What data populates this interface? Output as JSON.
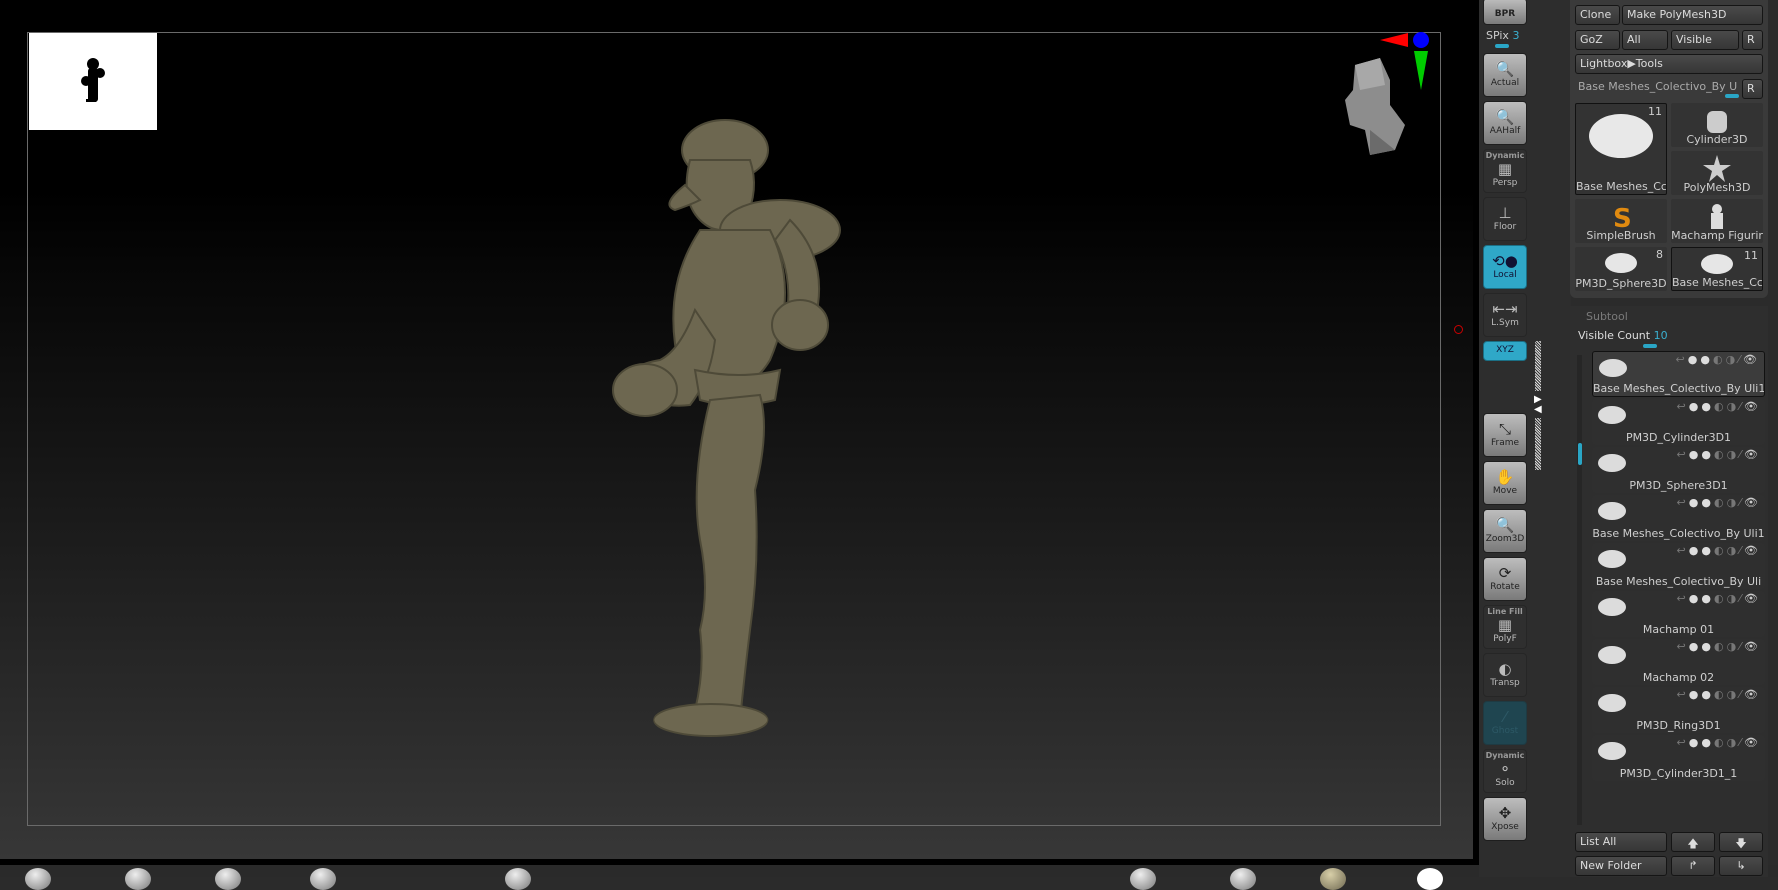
{
  "toolbar": {
    "bpr": "BPR",
    "spix_label": "SPix",
    "spix_value": "3",
    "buttons": [
      {
        "id": "actual",
        "label": "Actual",
        "icon": "magnifier-x1-icon",
        "glyph": "🔍"
      },
      {
        "id": "aahalf",
        "label": "AAHalf",
        "icon": "magnifier-half-icon",
        "glyph": "🔍"
      },
      {
        "id": "persp",
        "top": "Dynamic",
        "label": "Persp",
        "icon": "perspective-grid-icon",
        "glyph": "▦"
      },
      {
        "id": "floor",
        "label": "Floor",
        "icon": "floor-icon",
        "glyph": "⊥"
      },
      {
        "id": "local",
        "label": "Local",
        "icon": "local-rotate-icon",
        "glyph": "⟲●"
      },
      {
        "id": "lsym",
        "label": "L.Sym",
        "icon": "symmetry-icon",
        "glyph": "⇤⇥"
      },
      {
        "id": "xyz",
        "label": "XYZ",
        "icon": "xyz-rotate-icon",
        "glyph": ""
      },
      {
        "id": "frame",
        "label": "Frame",
        "icon": "frame-icon",
        "glyph": "⤡"
      },
      {
        "id": "move",
        "label": "Move",
        "icon": "hand-icon",
        "glyph": "✋"
      },
      {
        "id": "zoom3d",
        "label": "Zoom3D",
        "icon": "zoom-icon",
        "glyph": "🔍"
      },
      {
        "id": "rotate",
        "label": "Rotate",
        "icon": "rotate-icon",
        "glyph": "⟳"
      },
      {
        "id": "polyf",
        "top": "Line Fill",
        "label": "PolyF",
        "icon": "polyframe-grid-icon",
        "glyph": "▦"
      },
      {
        "id": "transp",
        "label": "Transp",
        "icon": "transparency-icon",
        "glyph": "◐"
      },
      {
        "id": "ghost",
        "label": "Ghost",
        "icon": "ghost-icon",
        "glyph": "⁄"
      },
      {
        "id": "solo",
        "top": "Dynamic",
        "label": "Solo",
        "icon": "solo-icon",
        "glyph": "⚬"
      },
      {
        "id": "xpose",
        "label": "Xpose",
        "icon": "xpose-icon",
        "glyph": "✥"
      }
    ]
  },
  "tool_panel": {
    "clone": "Clone",
    "make_polymesh": "Make PolyMesh3D",
    "goz": "GoZ",
    "all": "All",
    "visible": "Visible",
    "r": "R",
    "lightbox": "Lightbox▶Tools",
    "current_tool": "Base Meshes_Colectivo_By U",
    "tools": [
      {
        "name": "Base Meshes_Cc",
        "count": "11"
      },
      {
        "name": "Cylinder3D",
        "count": ""
      },
      {
        "name": "PolyMesh3D",
        "count": ""
      },
      {
        "name": "SimpleBrush",
        "count": ""
      },
      {
        "name": "Machamp Figurir",
        "count": ""
      },
      {
        "name": "PM3D_Sphere3D",
        "count": "8"
      },
      {
        "name": "Base Meshes_Cc",
        "count": "11"
      }
    ]
  },
  "subtool": {
    "header": "Subtool",
    "visible_count_label": "Visible Count",
    "visible_count": "10",
    "items": [
      "Base Meshes_Colectivo_By Uli1",
      "PM3D_Cylinder3D1",
      "PM3D_Sphere3D1",
      "Base Meshes_Colectivo_By Uli1",
      "Base Meshes_Colectivo_By Uli",
      "Machamp 01",
      "Machamp 02",
      "PM3D_Ring3D1",
      "PM3D_Cylinder3D1_1"
    ],
    "list_all": "List All",
    "new_folder": "New Folder"
  },
  "colors": {
    "accent": "#2fa8c8",
    "model": "#6d6750"
  }
}
